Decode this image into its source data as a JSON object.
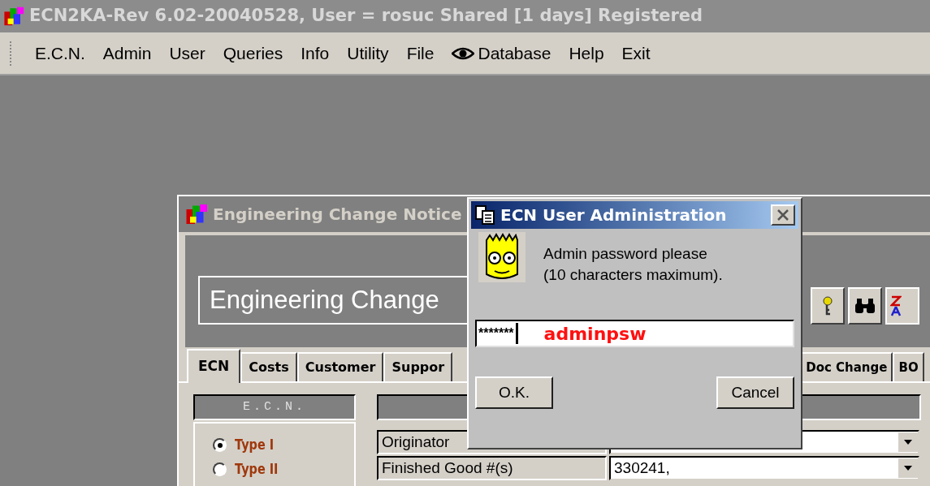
{
  "app_window": {
    "title": "ECN2KA-Rev 6.02-20040528, User = rosuc Shared [1 days] Registered"
  },
  "menu_bar": [
    {
      "label": "E.C.N.",
      "kind": "plain"
    },
    {
      "label": "Admin",
      "kind": "plain"
    },
    {
      "label": "User",
      "kind": "plain"
    },
    {
      "label": "Queries",
      "kind": "plain"
    },
    {
      "label": "Info",
      "kind": "plain"
    },
    {
      "label": "Utility",
      "kind": "plain"
    },
    {
      "label": "File",
      "kind": "plain"
    },
    {
      "label": "Database",
      "kind": "icon"
    },
    {
      "label": "Help",
      "kind": "plain"
    },
    {
      "label": "Exit",
      "kind": "plain"
    }
  ],
  "ecn_window": {
    "title": "Engineering Change Notice",
    "header": "Engineering Change",
    "tabs_left": [
      {
        "label": "ECN",
        "selected": true
      },
      {
        "label": "Costs",
        "selected": false
      },
      {
        "label": "Customer",
        "selected": false
      },
      {
        "label": "Suppor",
        "selected": false
      }
    ],
    "tabs_right": [
      {
        "label": "Doc Change",
        "selected": false
      },
      {
        "label": "BO",
        "selected": false
      }
    ],
    "ecn_panel": {
      "title": "E.C.N.",
      "types": [
        {
          "label": "Type I",
          "selected": true
        },
        {
          "label": "Type II",
          "selected": false
        }
      ]
    },
    "fields": [
      {
        "label": "Originator"
      },
      {
        "label": "Finished Good #(s)",
        "value": "330241,"
      }
    ]
  },
  "dialog": {
    "title": "ECN User Administration",
    "message_lines": [
      "Admin password please",
      "(10 characters maximum)."
    ],
    "password_value": "*******",
    "annotation": "adminpsw",
    "buttons": [
      "O.K.",
      "Cancel"
    ]
  }
}
